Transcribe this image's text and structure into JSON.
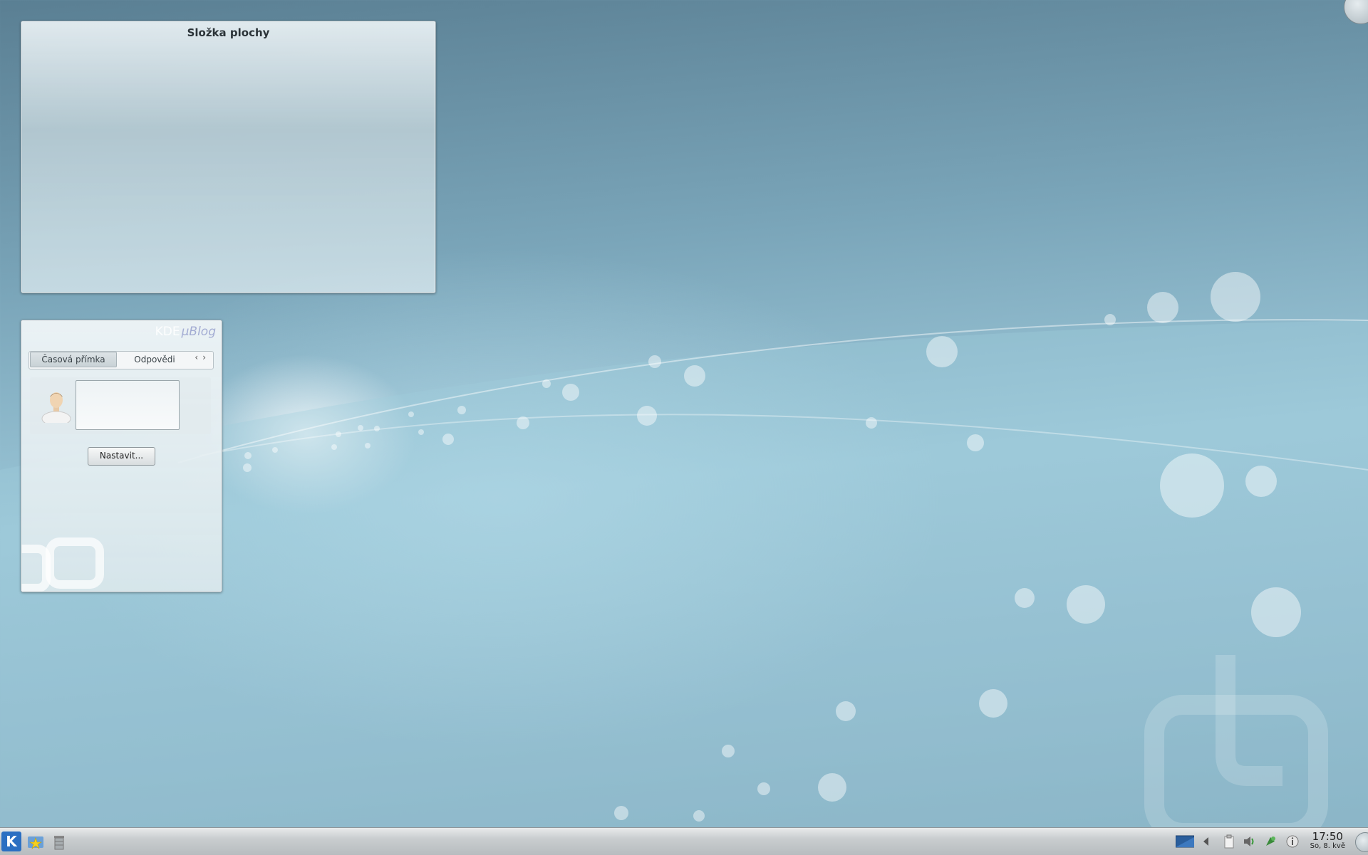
{
  "desktop": {
    "folder_widget": {
      "title": "Složka plochy"
    },
    "ublog_widget": {
      "logo_prefix": "KDE",
      "logo": "µBlog",
      "tabs": [
        {
          "label": "Časová přímka"
        },
        {
          "label": "Odpovědi"
        }
      ],
      "configure_button": "Nastavit..."
    }
  },
  "taskbar": {
    "clock_time": "17:50",
    "clock_date": "So, 8. kvě"
  }
}
